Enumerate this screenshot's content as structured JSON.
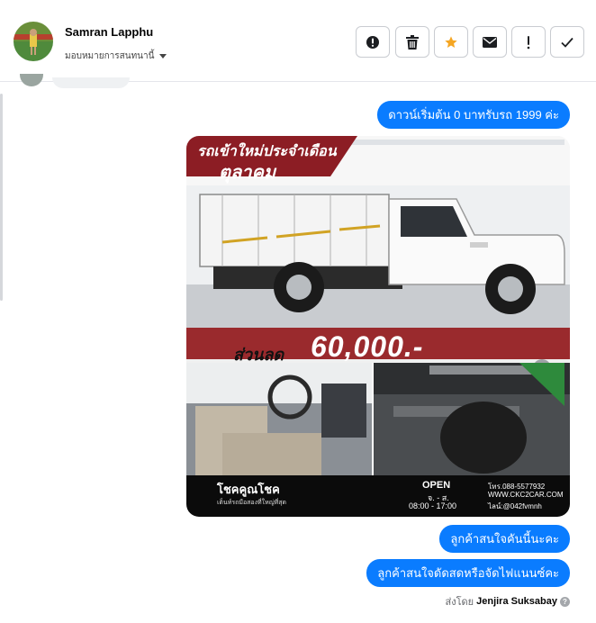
{
  "contact": {
    "name": "Samran Lapphu",
    "assign_label": "มอบหมายการสนทนานี้"
  },
  "toolbar": [
    {
      "name": "report-button",
      "icon": "exclamation-circle-icon"
    },
    {
      "name": "delete-button",
      "icon": "trash-icon"
    },
    {
      "name": "star-button",
      "icon": "star-icon",
      "color": "#f5a623"
    },
    {
      "name": "mark-unread-button",
      "icon": "envelope-icon"
    },
    {
      "name": "follow-up-button",
      "icon": "exclamation-icon"
    },
    {
      "name": "done-button",
      "icon": "check-icon"
    }
  ],
  "messages": {
    "m1": "ดาวน์เริ่มต้น 0 บาทรับรถ 1999 ค่ะ",
    "m2": "ลูกค้าสนใจคันนี้นะคะ",
    "m3": "ลูกค้าสนใจดัดสดหรือจัดไฟแนนซ์คะ"
  },
  "ad": {
    "title_line1": "รถเข้าใหม่ประจำเดือน",
    "title_line2": "ตุลาคม",
    "discount_label": "ส่วนลด",
    "discount_amount": "60,000.-",
    "brand": "โชคคูณโชค",
    "brand_tagline": "เต็นท์รถมือสองที่ใหญ่ที่สุด",
    "open_title": "OPEN",
    "open_days": "จ. - ส.",
    "open_hours": "08:00 - 17:00",
    "phone": "โทร.088-5577932",
    "website": "WWW.CKC2CAR.COM",
    "line": "ไลน์:@042fvmnh"
  },
  "sent_by": {
    "prefix": "ส่งโดย",
    "name": "Jenjira Suksabay"
  },
  "colors": {
    "accent": "#0a7cff",
    "star": "#f5a623"
  }
}
